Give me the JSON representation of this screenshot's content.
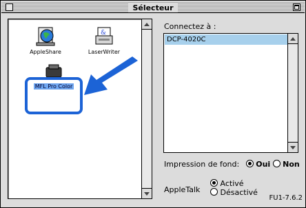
{
  "window": {
    "title": "Sélecteur"
  },
  "left_list": {
    "items": [
      {
        "label": "AppleShare"
      },
      {
        "label": "LaserWriter"
      },
      {
        "label": "MFL Pro Color"
      }
    ]
  },
  "right_panel": {
    "connect_label": "Connectez à :",
    "devices": [
      "DCP-4020C"
    ],
    "background_printing": {
      "label": "Impression de fond:",
      "oui": "Oui",
      "non": "Non",
      "selected": "Oui"
    },
    "appletalk": {
      "label": "AppleTalk",
      "active": "Activé",
      "inactive": "Désactivé",
      "selected": "Activé"
    }
  },
  "version": "FU1-7.6.2",
  "colors": {
    "highlight": "#1c63d6",
    "selection": "#a7d0ec"
  }
}
